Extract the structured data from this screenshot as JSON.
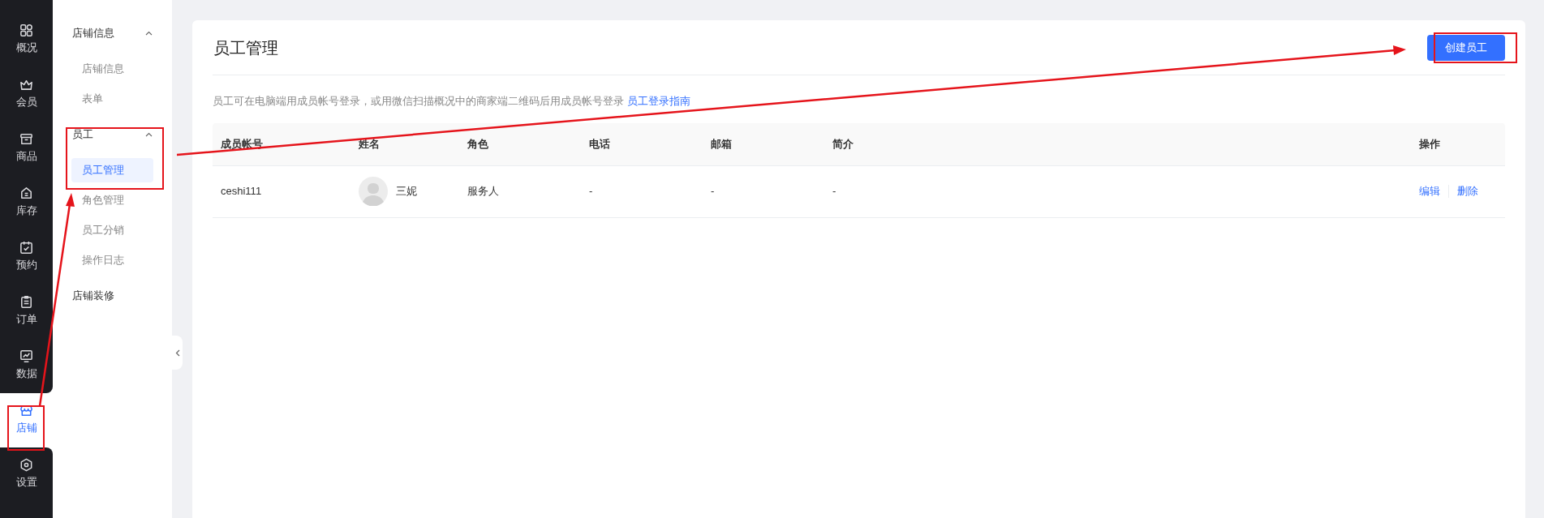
{
  "rail": {
    "items": [
      {
        "label": "概况",
        "selected": false
      },
      {
        "label": "会员",
        "selected": false
      },
      {
        "label": "商品",
        "selected": false
      },
      {
        "label": "库存",
        "selected": false
      },
      {
        "label": "预约",
        "selected": false
      },
      {
        "label": "订单",
        "selected": false
      },
      {
        "label": "数据",
        "selected": false
      },
      {
        "label": "店铺",
        "selected": true
      },
      {
        "label": "设置",
        "selected": false
      }
    ]
  },
  "menu": {
    "groups": [
      {
        "label": "店铺信息",
        "expanded": true,
        "children": [
          {
            "label": "店铺信息",
            "selected": false
          },
          {
            "label": "表单",
            "selected": false
          }
        ]
      },
      {
        "label": "员工",
        "expanded": true,
        "children": [
          {
            "label": "员工管理",
            "selected": true
          },
          {
            "label": "角色管理",
            "selected": false
          },
          {
            "label": "员工分销",
            "selected": false
          },
          {
            "label": "操作日志",
            "selected": false
          }
        ]
      },
      {
        "label": "店铺装修"
      }
    ]
  },
  "page": {
    "title": "员工管理",
    "create_button": "创建员工",
    "notice": "员工可在电脑端用成员帐号登录，或用微信扫描概况中的商家端二维码后用成员帐号登录",
    "notice_link": "员工登录指南"
  },
  "table": {
    "columns": [
      "成员帐号",
      "姓名",
      "角色",
      "电话",
      "邮箱",
      "简介",
      "操作"
    ],
    "rows": [
      {
        "account": "ceshi111",
        "name": "三妮",
        "role": "服务人",
        "phone": "-",
        "email": "-",
        "intro": "-",
        "actions": [
          "编辑",
          "删除"
        ]
      }
    ]
  }
}
